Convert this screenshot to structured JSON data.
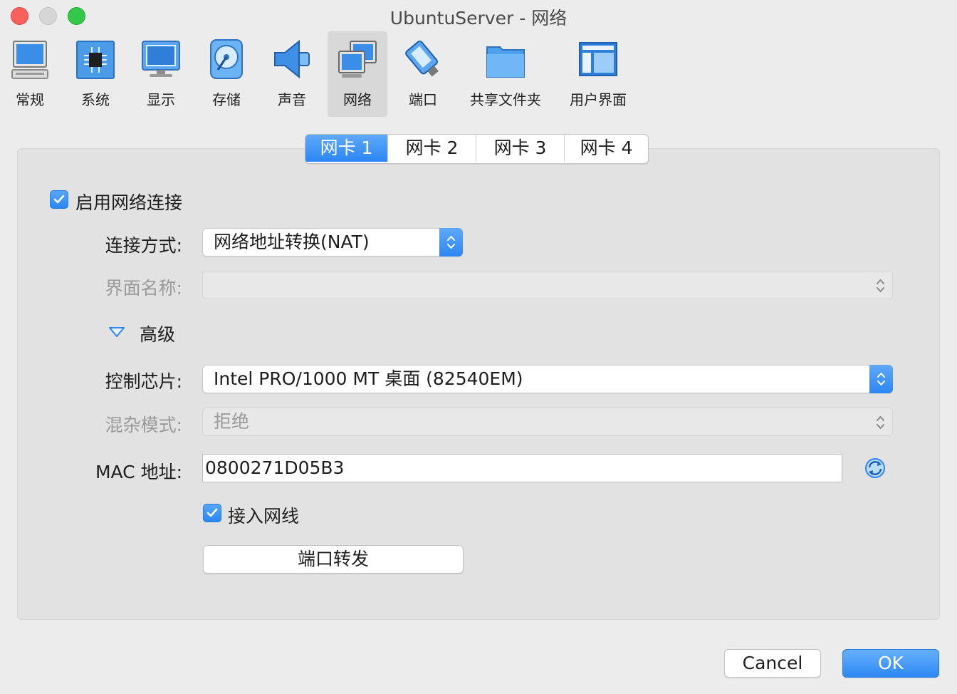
{
  "window": {
    "title": "UbuntuServer - 网络"
  },
  "toolbar": {
    "items": [
      {
        "label": "常规",
        "icon": "general-monitor-icon"
      },
      {
        "label": "系统",
        "icon": "system-chip-icon"
      },
      {
        "label": "显示",
        "icon": "display-monitor-icon"
      },
      {
        "label": "存储",
        "icon": "storage-disk-icon"
      },
      {
        "label": "声音",
        "icon": "audio-speaker-icon"
      },
      {
        "label": "网络",
        "icon": "network-icon",
        "selected": true
      },
      {
        "label": "端口",
        "icon": "ports-plug-icon"
      },
      {
        "label": "共享文件夹",
        "icon": "shared-folder-icon"
      },
      {
        "label": "用户界面",
        "icon": "user-interface-icon"
      }
    ]
  },
  "tabs": [
    {
      "label": "网卡 1",
      "active": true
    },
    {
      "label": "网卡 2"
    },
    {
      "label": "网卡 3"
    },
    {
      "label": "网卡 4"
    }
  ],
  "form": {
    "enable_label": "启用网络连接",
    "enable_checked": true,
    "attached_label": "连接方式:",
    "attached_value": "网络地址转换(NAT)",
    "name_label": "界面名称:",
    "name_value": "",
    "advanced_label": "高级",
    "adapter_label": "控制芯片:",
    "adapter_value": "Intel PRO/1000 MT 桌面 (82540EM)",
    "promisc_label": "混杂模式:",
    "promisc_value": "拒绝",
    "mac_label": "MAC 地址:",
    "mac_value": "0800271D05B3",
    "cable_label": "接入网线",
    "cable_checked": true,
    "port_forward_label": "端口转发"
  },
  "footer": {
    "cancel_label": "Cancel",
    "ok_label": "OK"
  },
  "colors": {
    "accent": "#2c86f5",
    "window_bg": "#ececec",
    "panel_bg": "#e2e2e2",
    "disabled_text": "#9a9a9a"
  }
}
